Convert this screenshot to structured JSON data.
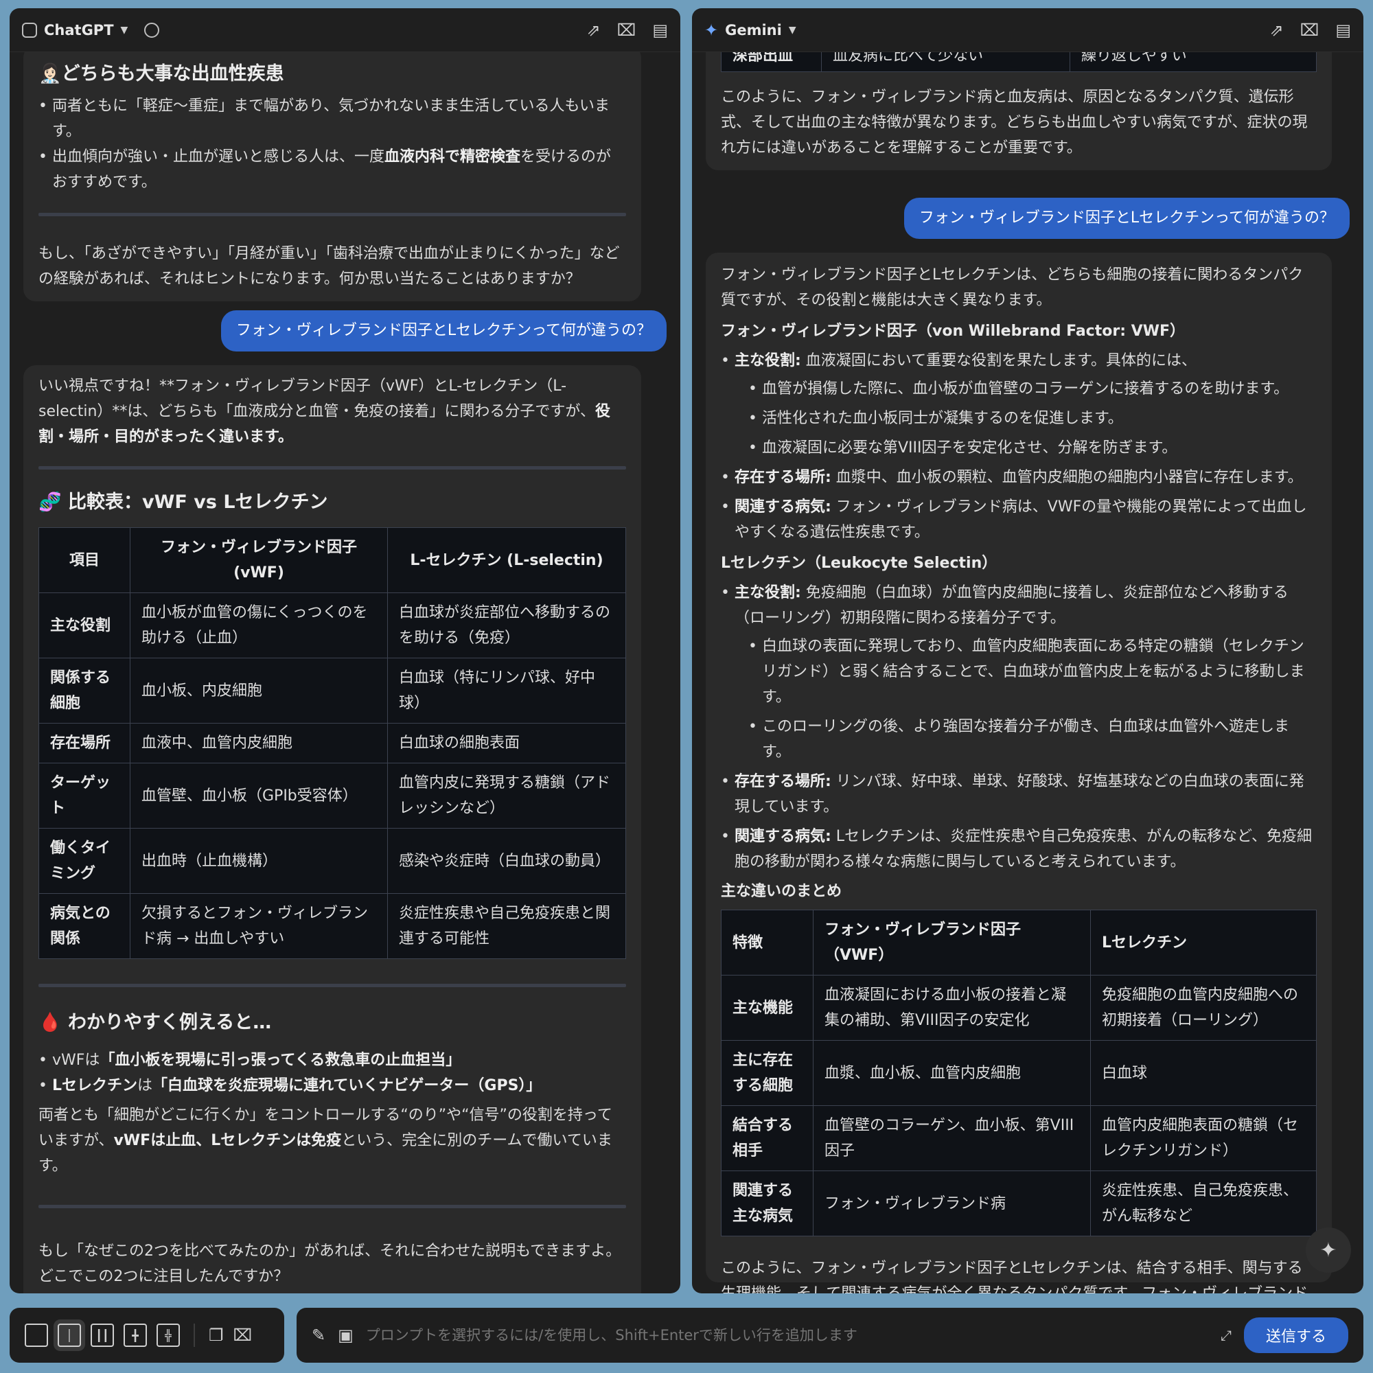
{
  "left": {
    "app": "ChatGPT",
    "b1": {
      "h": "👩🏻‍⚕️どちらも大事な出血性疾患",
      "l1": "両者ともに「軽症〜重症」まで幅があり、気づかれないまま生活している人もいます。",
      "l2a": "出血傾向が強い・止血が遅いと感じる人は、一度",
      "l2b": "血液内科で精密検査",
      "l2c": "を受けるのがおすすめです。",
      "p": "もし、「あざができやすい」「月経が重い」「歯科治療で出血が止まりにくかった」などの経験があれば、それはヒントになります。何か思い当たることはありますか？"
    },
    "question": "フォン・ヴィレブランド因子とLセレクチンって何が違うの？",
    "b2": {
      "p1a": "いい視点ですね！**フォン・ヴィレブランド因子（vWF）とL-セレクチン（L-selectin）**は、どちらも「血液成分と血管・免疫の接着」に関わる分子ですが、",
      "p1b": "役割・場所・目的がまったく違います。",
      "h": "🧬 比較表：vWF vs Lセレクチン",
      "table": {
        "headers": [
          "項目",
          "フォン・ヴィレブランド因子 (vWF)",
          "L-セレクチン (L-selectin)"
        ],
        "rows": [
          [
            "主な役割",
            "血小板が血管の傷にくっつくのを助ける（止血）",
            "白血球が炎症部位へ移動するのを助ける（免疫）"
          ],
          [
            "関係する細胞",
            "血小板、内皮細胞",
            "白血球（特にリンパ球、好中球）"
          ],
          [
            "存在場所",
            "血液中、血管内皮細胞",
            "白血球の細胞表面"
          ],
          [
            "ターゲット",
            "血管壁、血小板（GPIb受容体）",
            "血管内皮に発現する糖鎖（アドレッシンなど）"
          ],
          [
            "働くタイミング",
            "出血時（止血機構）",
            "感染や炎症時（白血球の動員）"
          ],
          [
            "病気との関係",
            "欠損するとフォン・ヴィレブランド病 → 出血しやすい",
            "炎症性疾患や自己免疫疾患と関連する可能性"
          ]
        ]
      },
      "h2": "🩸 わかりやすく例えると…",
      "l1a": "vWFは",
      "l1b": "「血小板を現場に引っ張ってくる救急車の止血担当」",
      "l2a": "Lセレクチン",
      "l2b": "は",
      "l2c": "「白血球を炎症現場に連れていくナビゲーター（GPS）」",
      "p2a": "両者とも「細胞がどこに行くか」をコントロールする“のり”や“信号”の役割を持っていますが、",
      "p2b": "vWFは止血、Lセレクチンは免疫",
      "p2c": "という、完全に別のチームで働いています。",
      "p3": "もし「なぜこの2つを比べてみたのか」があれば、それに合わせた説明もできますよ。どこでこの2つに注目したんですか？"
    }
  },
  "right": {
    "app": "Gemini",
    "b1": {
      "row": [
        "深部出血",
        "血友病に比べて少ない",
        "繰り返しやすい"
      ],
      "p": "このように、フォン・ヴィレブランド病と血友病は、原因となるタンパク質、遺伝形式、そして出血の主な特徴が異なります。どちらも出血しやすい病気ですが、症状の現れ方には違いがあることを理解することが重要です。"
    },
    "question": "フォン・ヴィレブランド因子とLセレクチンって何が違うの？",
    "b2": {
      "p1": "フォン・ヴィレブランド因子とLセレクチンは、どちらも細胞の接着に関わるタンパク質ですが、その役割と機能は大きく異なります。",
      "h1": "フォン・ヴィレブランド因子（von Willebrand Factor: VWF）",
      "v1k": "主な役割:",
      "v1v": " 血液凝固において重要な役割を果たします。具体的には、",
      "v1s1": "血管が損傷した際に、血小板が血管壁のコラーゲンに接着するのを助けます。",
      "v1s2": "活性化された血小板同士が凝集するのを促進します。",
      "v1s3": "血液凝固に必要な第VIII因子を安定化させ、分解を防ぎます。",
      "v2k": "存在する場所:",
      "v2v": " 血漿中、血小板の顆粒、血管内皮細胞の細胞内小器官に存在します。",
      "v3k": "関連する病気:",
      "v3v": " フォン・ヴィレブランド病は、VWFの量や機能の異常によって出血しやすくなる遺伝性疾患です。",
      "h2": "Lセレクチン（Leukocyte Selectin）",
      "s1k": "主な役割:",
      "s1v": " 免疫細胞（白血球）が血管内皮細胞に接着し、炎症部位などへ移動する（ローリング）初期段階に関わる接着分子です。",
      "s1s1": "白血球の表面に発現しており、血管内皮細胞表面にある特定の糖鎖（セレクチンリガンド）と弱く結合することで、白血球が血管内皮上を転がるように移動します。",
      "s1s2": "このローリングの後、より強固な接着分子が働き、白血球は血管外へ遊走します。",
      "s2k": "存在する場所:",
      "s2v": " リンパ球、好中球、単球、好酸球、好塩基球などの白血球の表面に発現しています。",
      "s3k": "関連する病気:",
      "s3v": " Lセレクチンは、炎症性疾患や自己免疫疾患、がんの転移など、免疫細胞の移動が関わる様々な病態に関与していると考えられています。",
      "h3": "主な違いのまとめ",
      "table": {
        "headers": [
          "特徴",
          "フォン・ヴィレブランド因子（VWF）",
          "Lセレクチン"
        ],
        "rows": [
          [
            "主な機能",
            "血液凝固における血小板の接着と凝集の補助、第VIII因子の安定化",
            "免疫細胞の血管内皮細胞への初期接着（ローリング）"
          ],
          [
            "主に存在する細胞",
            "血漿、血小板、血管内皮細胞",
            "白血球"
          ],
          [
            "結合する相手",
            "血管壁のコラーゲン、血小板、第VIII因子",
            "血管内皮細胞表面の糖鎖（セレクチンリガンド）"
          ],
          [
            "関連する主な病気",
            "フォン・ヴィレブランド病",
            "炎症性疾患、自己免疫疾患、がん転移など"
          ]
        ]
      },
      "p2": "このように、フォン・ヴィレブランド因子とLセレクチンは、結合する相手、関与する生理機能、そして関連する病気が全く異なるタンパク質です。フォン・ヴィレブランド因子は主に止血に関わるのに対し、Lセレクチンは免疫細胞の遊走に関わるという点で、その役割は明確に区別されます。"
    }
  },
  "prompt": {
    "placeholder": "プロンプトを選択するには/を使用し、Shift+Enterで新しい行を追加します",
    "send": "送信する"
  },
  "icons": {
    "share": "share-icon",
    "clear": "broom-icon",
    "notes": "notes-icon"
  },
  "colors": {
    "accent": "#2d62c5",
    "panel": "#1f1f1f",
    "bubble": "#2a2a2a",
    "background": "#6f9ebd"
  }
}
